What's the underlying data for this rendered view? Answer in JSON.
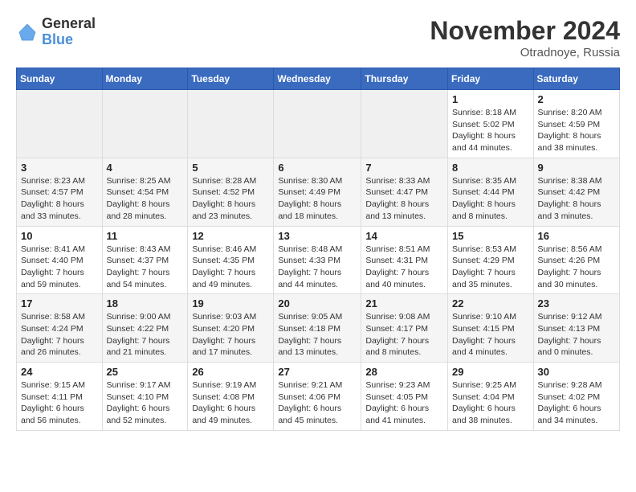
{
  "logo": {
    "text_general": "General",
    "text_blue": "Blue"
  },
  "title": "November 2024",
  "location": "Otradnoye, Russia",
  "days_of_week": [
    "Sunday",
    "Monday",
    "Tuesday",
    "Wednesday",
    "Thursday",
    "Friday",
    "Saturday"
  ],
  "weeks": [
    [
      {
        "day": "",
        "info": ""
      },
      {
        "day": "",
        "info": ""
      },
      {
        "day": "",
        "info": ""
      },
      {
        "day": "",
        "info": ""
      },
      {
        "day": "",
        "info": ""
      },
      {
        "day": "1",
        "info": "Sunrise: 8:18 AM\nSunset: 5:02 PM\nDaylight: 8 hours and 44 minutes."
      },
      {
        "day": "2",
        "info": "Sunrise: 8:20 AM\nSunset: 4:59 PM\nDaylight: 8 hours and 38 minutes."
      }
    ],
    [
      {
        "day": "3",
        "info": "Sunrise: 8:23 AM\nSunset: 4:57 PM\nDaylight: 8 hours and 33 minutes."
      },
      {
        "day": "4",
        "info": "Sunrise: 8:25 AM\nSunset: 4:54 PM\nDaylight: 8 hours and 28 minutes."
      },
      {
        "day": "5",
        "info": "Sunrise: 8:28 AM\nSunset: 4:52 PM\nDaylight: 8 hours and 23 minutes."
      },
      {
        "day": "6",
        "info": "Sunrise: 8:30 AM\nSunset: 4:49 PM\nDaylight: 8 hours and 18 minutes."
      },
      {
        "day": "7",
        "info": "Sunrise: 8:33 AM\nSunset: 4:47 PM\nDaylight: 8 hours and 13 minutes."
      },
      {
        "day": "8",
        "info": "Sunrise: 8:35 AM\nSunset: 4:44 PM\nDaylight: 8 hours and 8 minutes."
      },
      {
        "day": "9",
        "info": "Sunrise: 8:38 AM\nSunset: 4:42 PM\nDaylight: 8 hours and 3 minutes."
      }
    ],
    [
      {
        "day": "10",
        "info": "Sunrise: 8:41 AM\nSunset: 4:40 PM\nDaylight: 7 hours and 59 minutes."
      },
      {
        "day": "11",
        "info": "Sunrise: 8:43 AM\nSunset: 4:37 PM\nDaylight: 7 hours and 54 minutes."
      },
      {
        "day": "12",
        "info": "Sunrise: 8:46 AM\nSunset: 4:35 PM\nDaylight: 7 hours and 49 minutes."
      },
      {
        "day": "13",
        "info": "Sunrise: 8:48 AM\nSunset: 4:33 PM\nDaylight: 7 hours and 44 minutes."
      },
      {
        "day": "14",
        "info": "Sunrise: 8:51 AM\nSunset: 4:31 PM\nDaylight: 7 hours and 40 minutes."
      },
      {
        "day": "15",
        "info": "Sunrise: 8:53 AM\nSunset: 4:29 PM\nDaylight: 7 hours and 35 minutes."
      },
      {
        "day": "16",
        "info": "Sunrise: 8:56 AM\nSunset: 4:26 PM\nDaylight: 7 hours and 30 minutes."
      }
    ],
    [
      {
        "day": "17",
        "info": "Sunrise: 8:58 AM\nSunset: 4:24 PM\nDaylight: 7 hours and 26 minutes."
      },
      {
        "day": "18",
        "info": "Sunrise: 9:00 AM\nSunset: 4:22 PM\nDaylight: 7 hours and 21 minutes."
      },
      {
        "day": "19",
        "info": "Sunrise: 9:03 AM\nSunset: 4:20 PM\nDaylight: 7 hours and 17 minutes."
      },
      {
        "day": "20",
        "info": "Sunrise: 9:05 AM\nSunset: 4:18 PM\nDaylight: 7 hours and 13 minutes."
      },
      {
        "day": "21",
        "info": "Sunrise: 9:08 AM\nSunset: 4:17 PM\nDaylight: 7 hours and 8 minutes."
      },
      {
        "day": "22",
        "info": "Sunrise: 9:10 AM\nSunset: 4:15 PM\nDaylight: 7 hours and 4 minutes."
      },
      {
        "day": "23",
        "info": "Sunrise: 9:12 AM\nSunset: 4:13 PM\nDaylight: 7 hours and 0 minutes."
      }
    ],
    [
      {
        "day": "24",
        "info": "Sunrise: 9:15 AM\nSunset: 4:11 PM\nDaylight: 6 hours and 56 minutes."
      },
      {
        "day": "25",
        "info": "Sunrise: 9:17 AM\nSunset: 4:10 PM\nDaylight: 6 hours and 52 minutes."
      },
      {
        "day": "26",
        "info": "Sunrise: 9:19 AM\nSunset: 4:08 PM\nDaylight: 6 hours and 49 minutes."
      },
      {
        "day": "27",
        "info": "Sunrise: 9:21 AM\nSunset: 4:06 PM\nDaylight: 6 hours and 45 minutes."
      },
      {
        "day": "28",
        "info": "Sunrise: 9:23 AM\nSunset: 4:05 PM\nDaylight: 6 hours and 41 minutes."
      },
      {
        "day": "29",
        "info": "Sunrise: 9:25 AM\nSunset: 4:04 PM\nDaylight: 6 hours and 38 minutes."
      },
      {
        "day": "30",
        "info": "Sunrise: 9:28 AM\nSunset: 4:02 PM\nDaylight: 6 hours and 34 minutes."
      }
    ]
  ]
}
